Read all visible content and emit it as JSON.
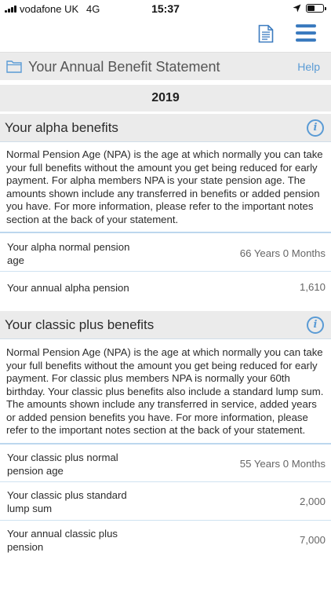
{
  "status_bar": {
    "carrier": "vodafone UK",
    "network": "4G",
    "time": "15:37",
    "icons": [
      "signal-icon",
      "location-icon",
      "battery-icon"
    ]
  },
  "app_bar": {
    "icons": [
      "document-icon",
      "menu-icon"
    ],
    "accent_color": "#3b7bbf"
  },
  "header": {
    "title": "Your Annual Benefit Statement",
    "help": "Help",
    "year": "2019"
  },
  "alpha": {
    "title": "Your alpha benefits",
    "description": "Normal Pension Age (NPA) is the age at which normally you can take your full benefits without the amount you get being reduced for early payment. For alpha members NPA is your state pension age. The amounts shown include any transferred in benefits or added pension you have. For more information, please refer to the important notes section at the back of your statement.",
    "rows": [
      {
        "label": "Your alpha normal pension age",
        "value": "66 Years 0 Months"
      },
      {
        "label": "Your annual alpha pension",
        "value": "1,610"
      }
    ]
  },
  "classic_plus": {
    "title": "Your classic plus benefits",
    "description": "Normal Pension Age (NPA) is the age at which normally you can take your full benefits without the amount you get being reduced for early payment. For classic plus members NPA is normally your 60th birthday. Your classic plus benefits also include a standard lump sum. The amounts shown include any transferred in service, added years or added pension benefits you have. For more information, please refer to the important notes section at the back of your statement.",
    "rows": [
      {
        "label": "Your classic plus normal pension age",
        "value": "55 Years 0 Months"
      },
      {
        "label": "Your classic plus standard lump sum",
        "value": "2,000"
      },
      {
        "label": "Your annual classic plus pension",
        "value": "7,000"
      }
    ]
  },
  "colors": {
    "link": "#5a9bd5",
    "section_background": "#ebebeb",
    "divider": "#cfe2f1"
  }
}
